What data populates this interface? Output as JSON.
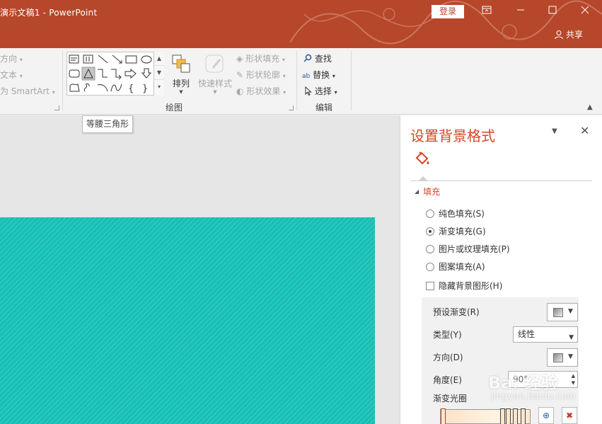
{
  "window": {
    "title": "演示文稿1  -  PowerPoint",
    "login_label": "登录",
    "share_label": "共享",
    "controls": [
      "ribbon-display",
      "minimize",
      "maximize",
      "close"
    ]
  },
  "ribbon": {
    "left_items": [
      {
        "label": "方向",
        "suffix": "▾"
      },
      {
        "label": "文本",
        "suffix": "▾"
      },
      {
        "label": "为 SmartArt",
        "suffix": "▾"
      }
    ],
    "drawing": {
      "arrange_label": "排列",
      "quick_styles_label": "快速样式",
      "shape_fill_label": "形状填充",
      "shape_outline_label": "形状轮廓",
      "shape_effects_label": "形状效果",
      "group_label": "绘图"
    },
    "editing": {
      "find_label": "查找",
      "replace_label": "替换",
      "select_label": "选择",
      "group_label": "编辑"
    },
    "shapes": [
      "text-box",
      "vertical-text-box",
      "line",
      "arrow-line",
      "rectangle",
      "oval",
      "rounded-rectangle",
      "isosceles-triangle",
      "elbow-connector",
      "elbow-arrow",
      "right-arrow",
      "down-arrow",
      "freeform",
      "scribble",
      "arc",
      "wave",
      "left-brace",
      "right-brace"
    ],
    "selected_shape": "isosceles-triangle"
  },
  "tooltip": {
    "text": "等腰三角形"
  },
  "slide": {
    "background_color": "#15c0b4"
  },
  "format_pane": {
    "title": "设置背景格式",
    "section_label": "填充",
    "fill_options": [
      {
        "label": "纯色填充(S)",
        "checked": false
      },
      {
        "label": "渐变填充(G)",
        "checked": true
      },
      {
        "label": "图片或纹理填充(P)",
        "checked": false
      },
      {
        "label": "图案填充(A)",
        "checked": false
      }
    ],
    "hide_background_label": "隐藏背景图形(H)",
    "preset_gradient_label": "预设渐变(R)",
    "type_label": "类型(Y)",
    "type_value": "线性",
    "direction_label": "方向(D)",
    "angle_label": "角度(E)",
    "angle_value": "90°",
    "gradient_stops_label": "渐变光圈"
  },
  "watermark": {
    "text": "Bai 经验",
    "sub": "jingyan.baidu.com"
  }
}
